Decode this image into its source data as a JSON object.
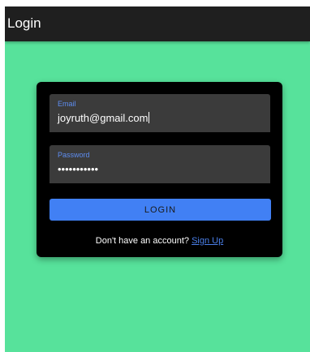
{
  "app_bar": {
    "title": "Login"
  },
  "login_form": {
    "email": {
      "label": "Email",
      "value": "joyruth@gmail.com"
    },
    "password": {
      "label": "Password",
      "value": "•••••••••••"
    },
    "submit_label": "LOGIN",
    "signup_prompt": "Don't have an account?",
    "signup_link": "Sign Up"
  },
  "colors": {
    "background": "#57e29b",
    "app_bar": "#1f1f1f",
    "card": "#000000",
    "field": "#3b3b3b",
    "accent": "#4180f4",
    "label": "#5e8df0"
  }
}
